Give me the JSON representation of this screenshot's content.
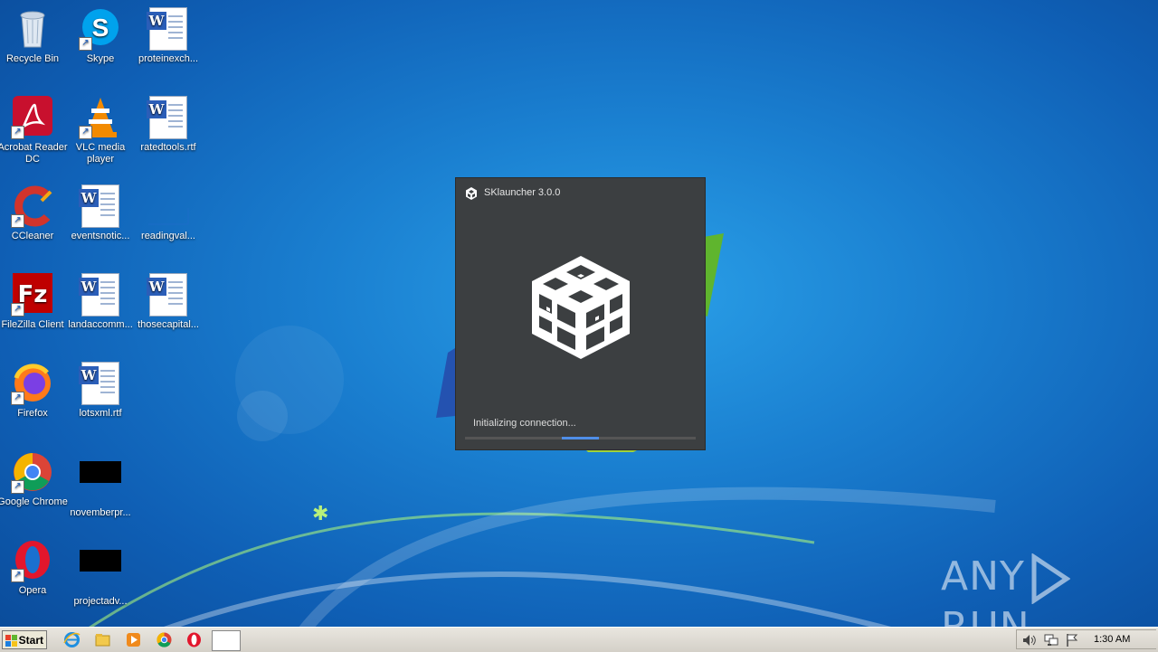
{
  "desktop": {
    "icons": [
      {
        "label": "Recycle Bin",
        "icon": "recycle-bin-icon"
      },
      {
        "label": "Skype",
        "icon": "skype-icon"
      },
      {
        "label": "proteinexch...",
        "icon": "word-document-icon"
      },
      {
        "label": "Acrobat Reader DC",
        "icon": "acrobat-icon"
      },
      {
        "label": "VLC media player",
        "icon": "vlc-icon"
      },
      {
        "label": "ratedtools.rtf",
        "icon": "word-document-icon"
      },
      {
        "label": "CCleaner",
        "icon": "ccleaner-icon"
      },
      {
        "label": "eventsnotic...",
        "icon": "word-document-icon"
      },
      {
        "label": "readingval...",
        "icon": "blank-file-icon"
      },
      {
        "label": "FileZilla Client",
        "icon": "filezilla-icon"
      },
      {
        "label": "landaccomm...",
        "icon": "word-document-icon"
      },
      {
        "label": "thosecapital...",
        "icon": "word-document-icon"
      },
      {
        "label": "Firefox",
        "icon": "firefox-icon"
      },
      {
        "label": "lotsxml.rtf",
        "icon": "word-document-icon"
      },
      {
        "label": "Google Chrome",
        "icon": "chrome-icon"
      },
      {
        "label": "novemberpr...",
        "icon": "black-thumbnail-icon"
      },
      {
        "label": "Opera",
        "icon": "opera-icon"
      },
      {
        "label": "projectadv...",
        "icon": "black-thumbnail-icon"
      }
    ]
  },
  "dialog": {
    "title": "SKlauncher 3.0.0",
    "status": "Initializing connection...",
    "progress_fraction": 0.16
  },
  "taskbar": {
    "start_label": "Start",
    "clock": "1:30 AM",
    "pinned": [
      "internet-explorer-icon",
      "explorer-icon",
      "media-player-icon",
      "chrome-icon",
      "opera-icon"
    ]
  },
  "watermark": {
    "left": "ANY",
    "right": "RUN"
  },
  "colors": {
    "dialog_bg": "#3c3f41",
    "progress": "#4f8ee8"
  }
}
